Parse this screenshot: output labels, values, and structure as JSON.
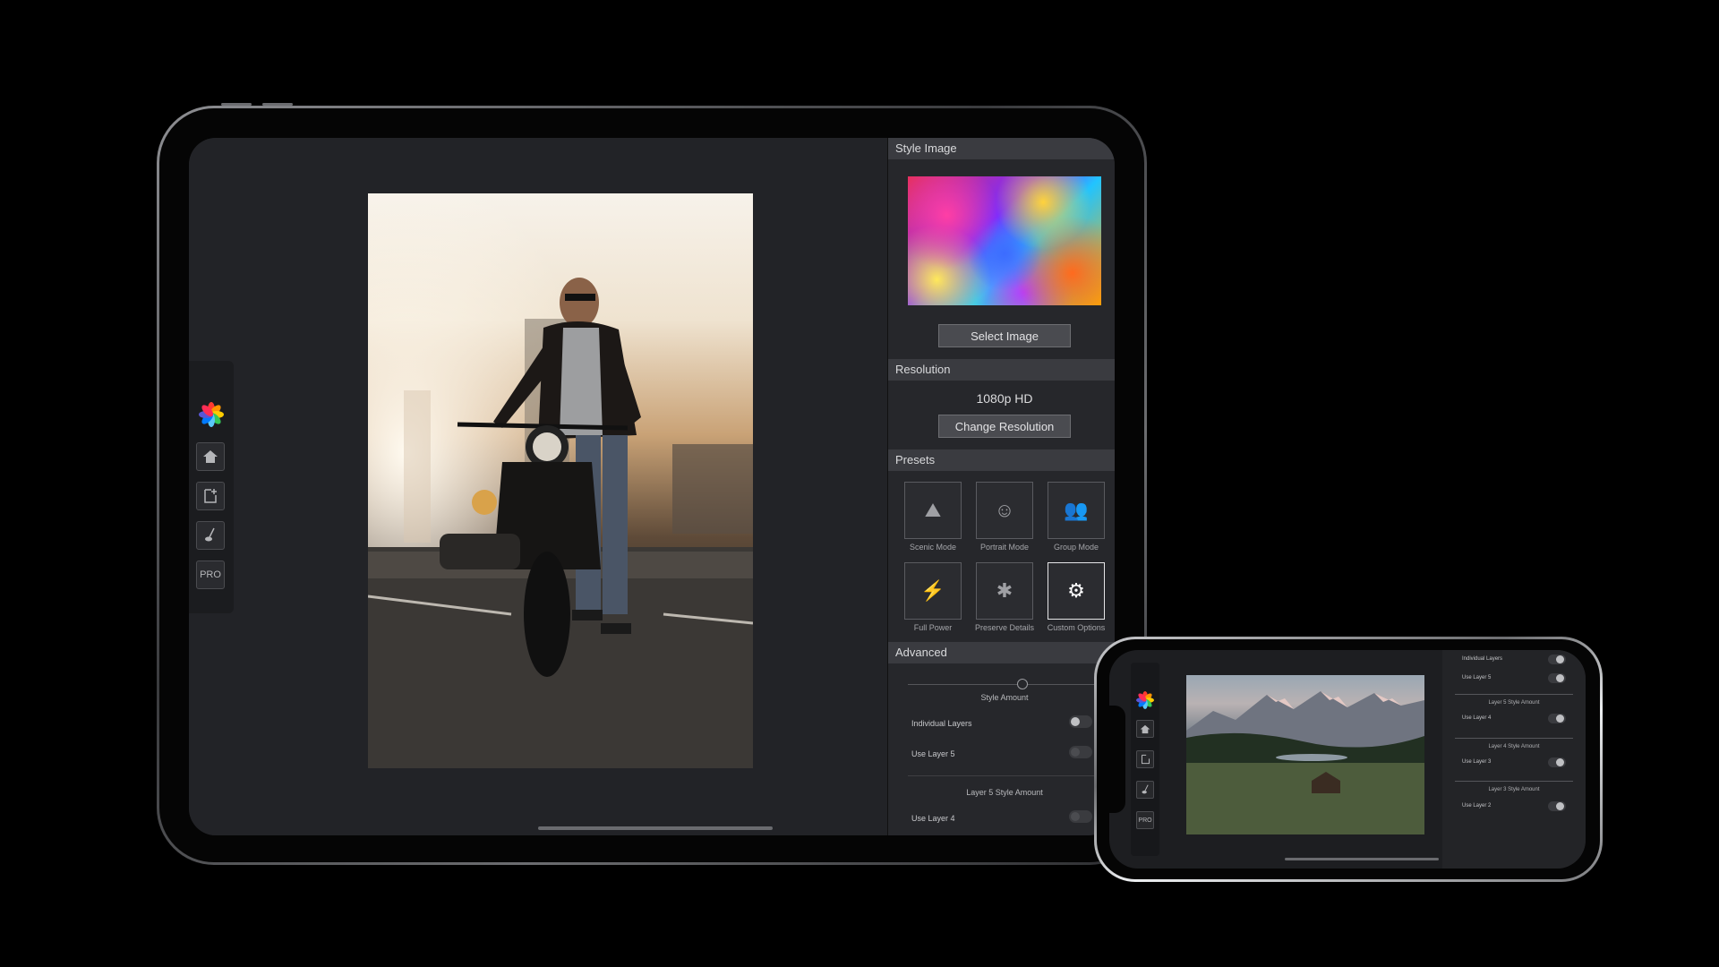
{
  "ipad": {
    "toolbar": {
      "logo_icon": "flower-logo-icon",
      "items": [
        {
          "icon": "home-icon",
          "label": ""
        },
        {
          "icon": "new-document-icon",
          "label": ""
        },
        {
          "icon": "brush-icon",
          "label": ""
        },
        {
          "icon": "",
          "label": "PRO"
        }
      ]
    },
    "panel": {
      "style_image": {
        "header": "Style Image",
        "button": "Select Image"
      },
      "resolution": {
        "header": "Resolution",
        "value": "1080p HD",
        "button": "Change Resolution"
      },
      "presets": {
        "header": "Presets",
        "items": [
          {
            "label": "Scenic Mode",
            "icon": "scenic-icon",
            "glyph": "⛰"
          },
          {
            "label": "Portrait Mode",
            "icon": "portrait-icon",
            "glyph": "☺"
          },
          {
            "label": "Group Mode",
            "icon": "group-icon",
            "glyph": "👥"
          },
          {
            "label": "Full Power",
            "icon": "lightning-icon",
            "glyph": "⚡"
          },
          {
            "label": "Preserve Details",
            "icon": "details-icon",
            "glyph": "✱"
          },
          {
            "label": "Custom Options",
            "icon": "gear-icon",
            "glyph": "⚙"
          }
        ],
        "selected": "Custom Options"
      },
      "advanced": {
        "header": "Advanced",
        "style_amount_label": "Style Amount",
        "individual_layers": "Individual Layers",
        "use_layer_5": "Use Layer 5",
        "layer_5_style_amount": "Layer 5 Style Amount",
        "use_layer_4": "Use Layer 4"
      }
    }
  },
  "iphone": {
    "toolbar": {
      "pro_label": "PRO"
    },
    "panel": {
      "individual_layers": "Individual Layers",
      "use_layer_5": "Use Layer 5",
      "layer_5_style_amount": "Layer 5 Style Amount",
      "use_layer_4": "Use Layer 4",
      "layer_4_style_amount": "Layer 4 Style Amount",
      "use_layer_3": "Use Layer 3",
      "layer_3_style_amount": "Layer 3 Style Amount",
      "use_layer_2": "Use Layer 2"
    }
  },
  "colors": {
    "panel_bg": "#26272b",
    "section_header": "#3a3b40",
    "canvas_bg": "#222327"
  }
}
